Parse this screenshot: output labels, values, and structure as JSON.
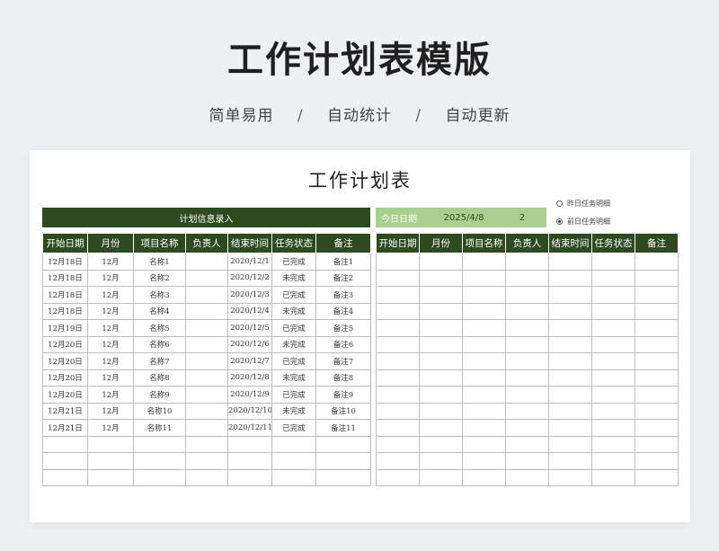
{
  "hero": {
    "title": "工作计划表模版",
    "tags": [
      "简单易用",
      "自动统计",
      "自动更新"
    ],
    "separator": "/"
  },
  "sheet": {
    "title": "工作计划表",
    "input_label": "计划信息录入",
    "date_label": "今日日期",
    "date_value": "2025/4/8",
    "count_value": "2",
    "radios": [
      {
        "label": "昨日任务明细",
        "checked": false
      },
      {
        "label": "前日任务明细",
        "checked": true
      }
    ],
    "headers": [
      "开始日期",
      "月份",
      "项目名称",
      "负责人",
      "结束时间",
      "任务状态",
      "备注"
    ],
    "rows": [
      [
        "12月18日",
        "12月",
        "名称1",
        "",
        "2020/12/1",
        "已完成",
        "备注1"
      ],
      [
        "12月18日",
        "12月",
        "名称2",
        "",
        "2020/12/2",
        "未完成",
        "备注2"
      ],
      [
        "12月18日",
        "12月",
        "名称3",
        "",
        "2020/12/3",
        "已完成",
        "备注3"
      ],
      [
        "12月18日",
        "12月",
        "名称4",
        "",
        "2020/12/4",
        "未完成",
        "备注4"
      ],
      [
        "12月19日",
        "12月",
        "名称5",
        "",
        "2020/12/5",
        "已完成",
        "备注5"
      ],
      [
        "12月20日",
        "12月",
        "名称6",
        "",
        "2020/12/6",
        "未完成",
        "备注6"
      ],
      [
        "12月20日",
        "12月",
        "名称7",
        "",
        "2020/12/7",
        "已完成",
        "备注7"
      ],
      [
        "12月20日",
        "12月",
        "名称8",
        "",
        "2020/12/8",
        "未完成",
        "备注8"
      ],
      [
        "12月20日",
        "12月",
        "名称9",
        "",
        "2020/12/9",
        "已完成",
        "备注9"
      ],
      [
        "12月21日",
        "12月",
        "名称10",
        "",
        "2020/12/10",
        "未完成",
        "备注10"
      ],
      [
        "12月21日",
        "12月",
        "名称11",
        "",
        "2020/12/11",
        "已完成",
        "备注11"
      ],
      [
        "",
        "",
        "",
        "",
        "",
        "",
        ""
      ],
      [
        "",
        "",
        "",
        "",
        "",
        "",
        ""
      ],
      [
        "",
        "",
        "",
        "",
        "",
        "",
        ""
      ]
    ]
  },
  "colors": {
    "header_green": "#2e4a1f",
    "light_green": "#a9cf8e"
  }
}
